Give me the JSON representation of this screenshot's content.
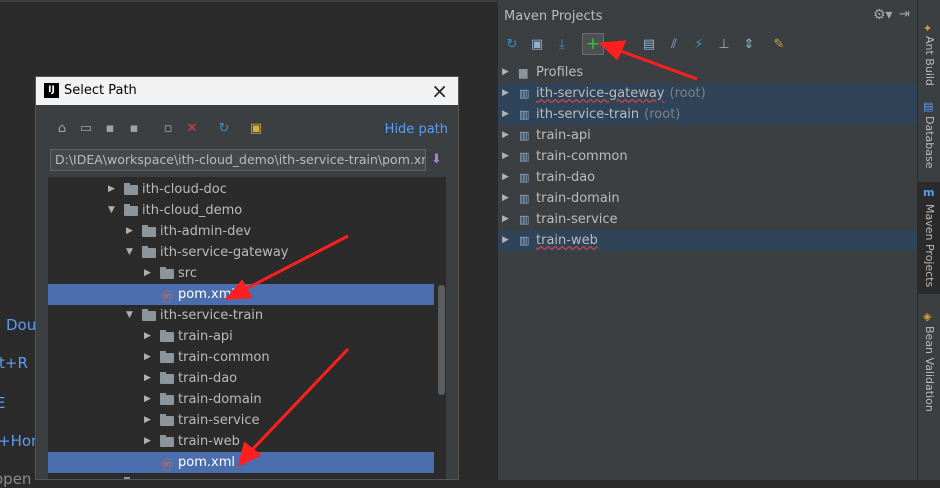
{
  "editor": {
    "hints": [
      "Dou",
      "ft+R",
      "E",
      "+Hor",
      "open"
    ]
  },
  "dialog": {
    "title": "Select Path",
    "hide_path": "Hide path",
    "path": "D:\\IDEA\\workspace\\ith-cloud_demo\\ith-service-train\\pom.xml",
    "toolbar": [
      "home-icon",
      "desktop-icon",
      "new-folder-icon",
      "new-file-icon",
      "collapse-icon",
      "delete-icon",
      "refresh-icon",
      "show-hidden-icon"
    ],
    "tree": [
      {
        "label": "ith-cloud-doc",
        "expanded": false,
        "type": "folder"
      },
      {
        "label": "ith-cloud_demo",
        "expanded": true,
        "type": "folder"
      },
      {
        "label": "ith-admin-dev",
        "expanded": false,
        "type": "folder"
      },
      {
        "label": "ith-service-gateway",
        "expanded": true,
        "type": "folder"
      },
      {
        "label": "src",
        "expanded": false,
        "type": "folder"
      },
      {
        "label": "pom.xml",
        "type": "maven-file",
        "selected": true
      },
      {
        "label": "ith-service-train",
        "expanded": true,
        "type": "folder"
      },
      {
        "label": "train-api",
        "expanded": false,
        "type": "folder"
      },
      {
        "label": "train-common",
        "expanded": false,
        "type": "folder"
      },
      {
        "label": "train-dao",
        "expanded": false,
        "type": "folder"
      },
      {
        "label": "train-domain",
        "expanded": false,
        "type": "folder"
      },
      {
        "label": "train-service",
        "expanded": false,
        "type": "folder"
      },
      {
        "label": "train-web",
        "expanded": false,
        "type": "folder"
      },
      {
        "label": "pom.xml",
        "type": "maven-file",
        "selected": true
      }
    ]
  },
  "maven": {
    "title": "Maven Projects",
    "toolbar": [
      "reimport-icon",
      "generate-sources-icon",
      "download-icon",
      "add-icon",
      "run-icon",
      "toggle-offline-icon",
      "skip-tests-icon",
      "show-dependencies-icon",
      "collapse-all-icon",
      "settings-icon"
    ],
    "items": [
      {
        "label": "Profiles",
        "root": "",
        "selected": false,
        "wavy": false
      },
      {
        "label": "ith-service-gateway",
        "root": "(root)",
        "selected": true,
        "wavy": true
      },
      {
        "label": "ith-service-train",
        "root": "(root)",
        "selected": true,
        "wavy": false
      },
      {
        "label": "train-api",
        "root": "",
        "selected": false,
        "wavy": false
      },
      {
        "label": "train-common",
        "root": "",
        "selected": false,
        "wavy": false
      },
      {
        "label": "train-dao",
        "root": "",
        "selected": false,
        "wavy": false
      },
      {
        "label": "train-domain",
        "root": "",
        "selected": false,
        "wavy": false
      },
      {
        "label": "train-service",
        "root": "",
        "selected": false,
        "wavy": false
      },
      {
        "label": "train-web",
        "root": "",
        "selected": true,
        "wavy": true
      }
    ]
  },
  "side_tabs": [
    "Ant Build",
    "Database",
    "Maven Projects",
    "Bean Validation"
  ],
  "colors": {
    "accent": "#589df6",
    "selection": "#4b6eaf",
    "annotation": "#ff1f1f"
  }
}
